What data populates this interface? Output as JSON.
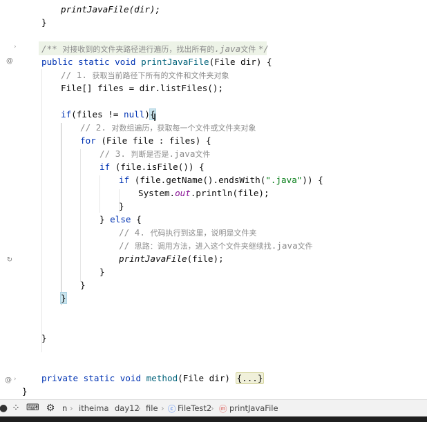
{
  "code": {
    "l1": "printJavaFile(dir);",
    "l2": "}",
    "doc_open": "/** ",
    "doc_text": "对接收到的文件夹路径进行遍历，找出所有的",
    "doc_java": ".java",
    "doc_text2": "文件 ",
    "doc_close": "*/",
    "sig_kw": "public static void ",
    "sig_name": "printJavaFile",
    "sig_rest": "(File dir) {",
    "c1_pre": "// 1. ",
    "c1_text": "获取当前路径下所有的文件和文件夹对象",
    "l_files": "File[] files = dir.listFiles();",
    "if1_kw": "if",
    "if1_a": "(files != ",
    "if1_null": "null",
    "if1_b": ")",
    "if1_brace": "{",
    "c2_pre": "// 2. ",
    "c2_text": "对数组遍历，获取每一个文件或文件夹对象",
    "for_kw": "for",
    "for_rest": " (File file : files) {",
    "c3_pre": "// 3. ",
    "c3_text": "判断是否是",
    "c3_java": ".java",
    "c3_text2": "文件",
    "if2_kw": "if",
    "if2_rest": " (file.isFile()) {",
    "if3_kw": "if",
    "if3_a": " (file.getName().endsWith(",
    "if3_str": "\".java\"",
    "if3_b": ")) {",
    "sys_a": "System.",
    "sys_out": "out",
    "sys_b": ".println(file);",
    "close_brace": "}",
    "else_a": "} ",
    "else_kw": "else",
    "else_b": " {",
    "c4_pre": "// 4. ",
    "c4_text": "代码执行到这里，说明是文件夹",
    "c5_pre": "// ",
    "c5_text": "思路：调用方法，进入这个文件夹继续找",
    "c5_java": ".java",
    "c5_text2": "文件",
    "rec_call": "printJavaFile",
    "rec_rest": "(file);",
    "if1_close": "}",
    "method_kw": "private static void ",
    "method_name": "method",
    "method_rest": "(File dir) ",
    "method_fold": "{...}",
    "class_close": "}"
  },
  "gutter_icons": {
    "fold_chevron": "chevron-right-icon",
    "override": "at-sign-icon",
    "recursion": "recursive-call-icon"
  },
  "breadcrumb": {
    "partial": "n",
    "items": [
      "itheima",
      "day12",
      "file",
      "FileTest2",
      "printJavaFile"
    ],
    "separator": "›"
  },
  "toolbar_icons": [
    "record-icon",
    "dots-icon",
    "keyboard-icon",
    "gear-icon"
  ],
  "colors": {
    "keyword": "#0033b3",
    "comment": "#8c8c8c",
    "string": "#067d17",
    "static_field": "#871094",
    "doc_highlight": "#edf3e7",
    "brace_match": "#c9e4ed"
  }
}
